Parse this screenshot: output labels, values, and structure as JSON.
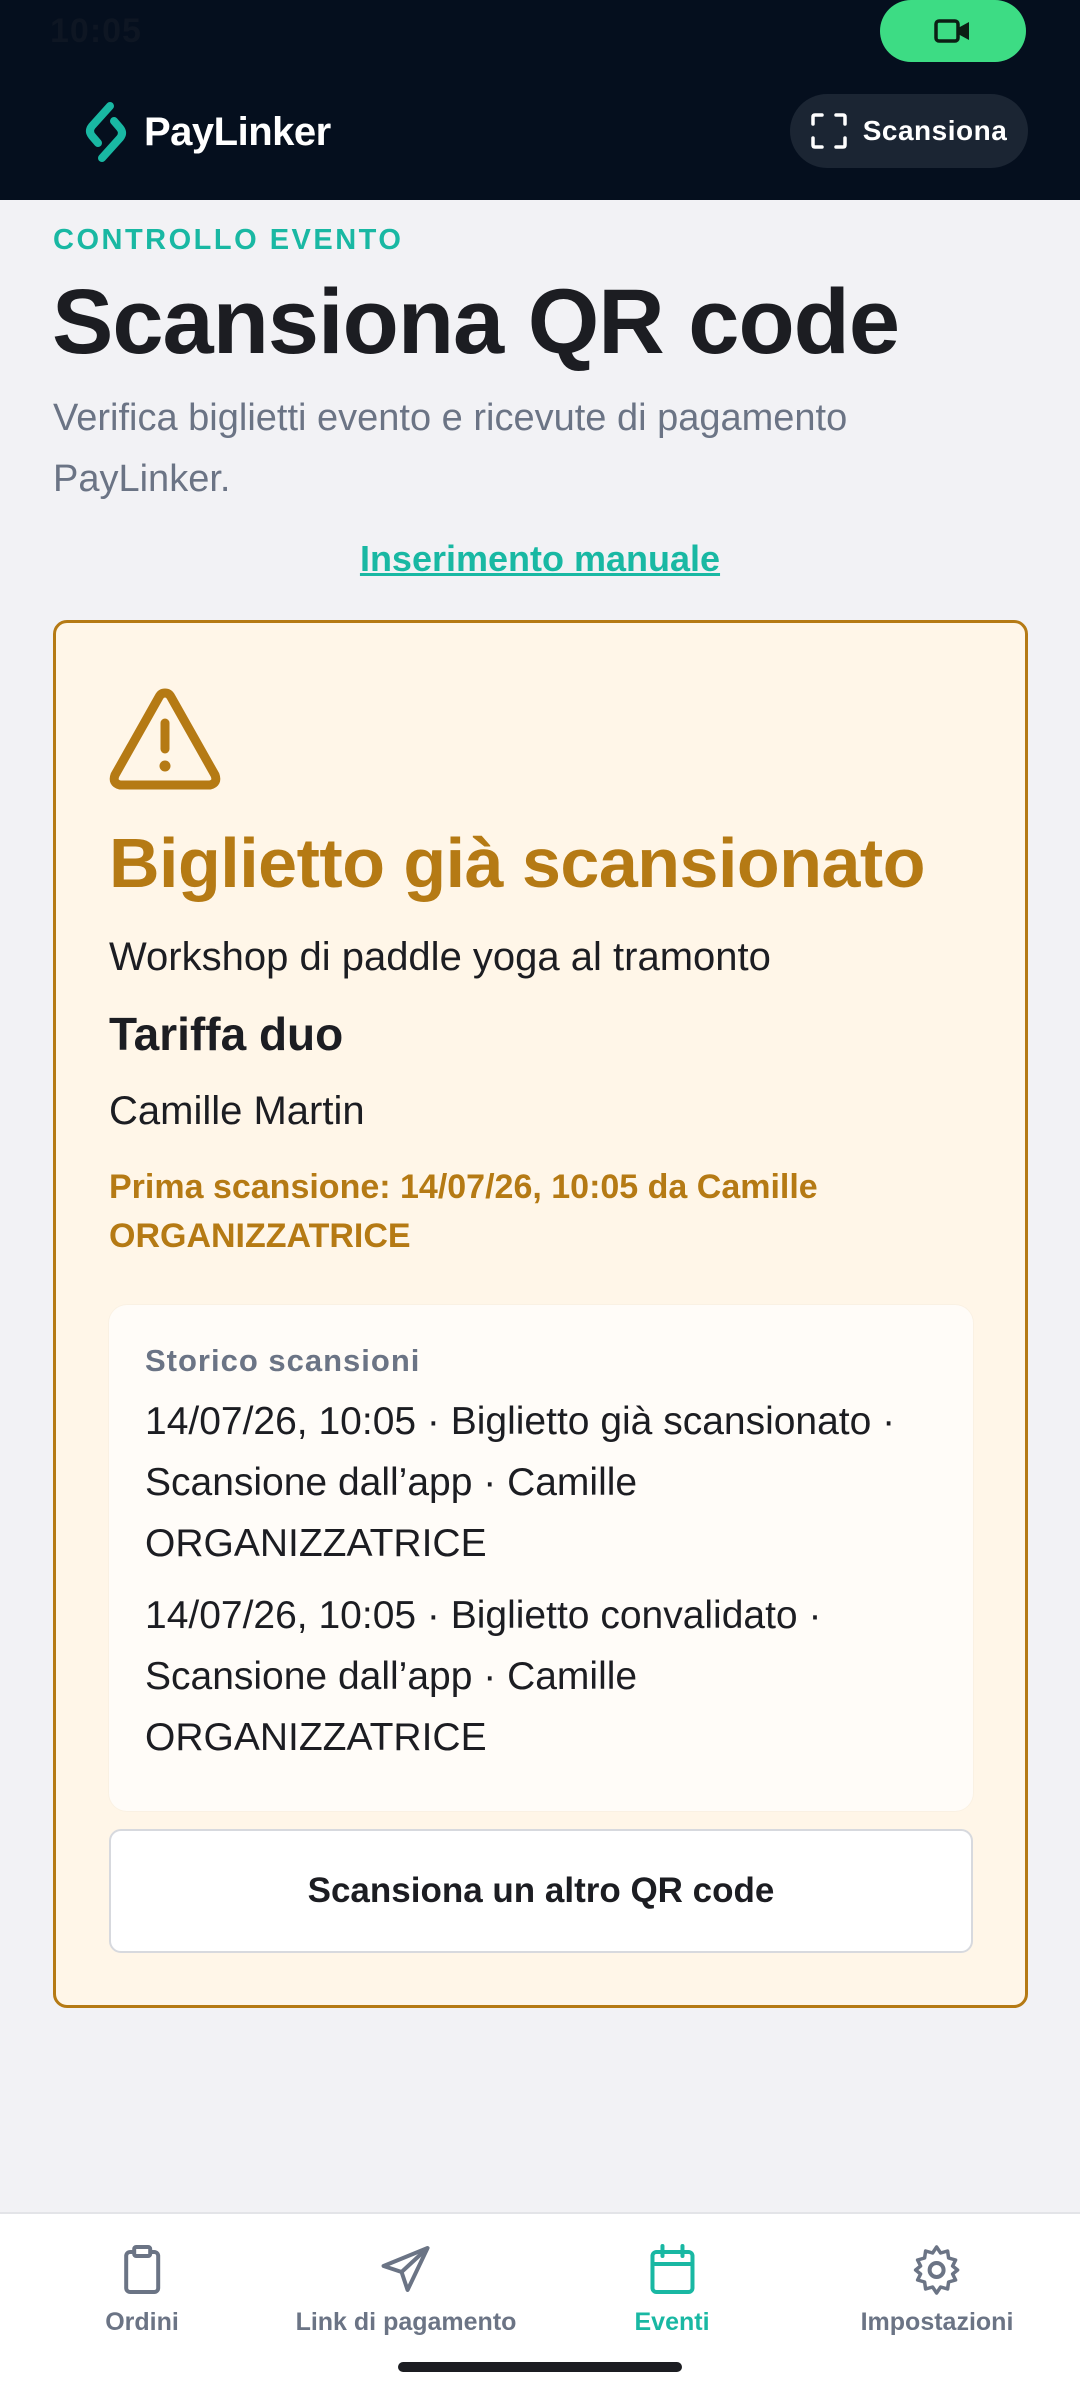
{
  "status_bar": {
    "time": "10:05"
  },
  "header": {
    "brand": "PayLinker",
    "scan_button_label": "Scansiona"
  },
  "page": {
    "eyebrow": "CONTROLLO EVENTO",
    "title": "Scansiona QR code",
    "subtitle": "Verifica biglietti evento e ricevute di pagamento PayLinker.",
    "manual_entry_link": "Inserimento manuale"
  },
  "result": {
    "status": "warning",
    "title": "Biglietto già scansionato",
    "event": "Workshop di paddle yoga al tramonto",
    "tariff": "Tariffa duo",
    "holder": "Camille Martin",
    "first_scan": "Prima scansione: 14/07/26, 10:05 da Camille ORGANIZZATRICE",
    "history": {
      "title": "Storico scansioni",
      "entries": [
        "14/07/26, 10:05 · Biglietto già scansionato · Scansione dall’app · Camille ORGANIZZATRICE",
        "14/07/26, 10:05 · Biglietto convalidato · Scansione dall’app · Camille ORGANIZZATRICE"
      ]
    },
    "scan_again_button": "Scansiona un altro QR code"
  },
  "bottom_nav": {
    "items": [
      {
        "label": "Ordini",
        "icon": "clipboard-icon",
        "active": false
      },
      {
        "label": "Link di pagamento",
        "icon": "send-icon",
        "active": false
      },
      {
        "label": "Eventi",
        "icon": "calendar-icon",
        "active": true
      },
      {
        "label": "Impostazioni",
        "icon": "gear-icon",
        "active": false
      }
    ]
  },
  "colors": {
    "header_bg": "#050f1e",
    "accent": "#19b8a3",
    "warning": "#b57a14",
    "warning_bg": "#fff6e8",
    "recording_pill": "#3ddc84"
  }
}
